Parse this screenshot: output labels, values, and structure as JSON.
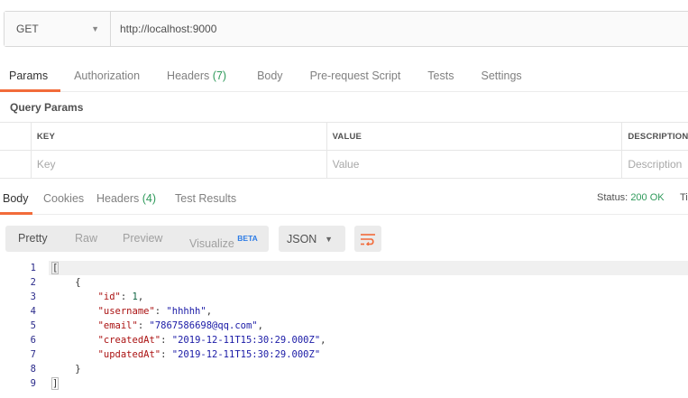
{
  "request": {
    "method": "GET",
    "url": "http://localhost:9000"
  },
  "request_tabs": [
    {
      "label": "Params",
      "count": ""
    },
    {
      "label": "Authorization",
      "count": ""
    },
    {
      "label": "Headers",
      "count": "(7)"
    },
    {
      "label": "Body",
      "count": ""
    },
    {
      "label": "Pre-request Script",
      "count": ""
    },
    {
      "label": "Tests",
      "count": ""
    },
    {
      "label": "Settings",
      "count": ""
    }
  ],
  "query_params": {
    "title": "Query Params",
    "headers": [
      "KEY",
      "VALUE",
      "DESCRIPTION"
    ],
    "placeholders": [
      "Key",
      "Value",
      "Description"
    ]
  },
  "response_tabs": [
    {
      "label": "Body",
      "count": ""
    },
    {
      "label": "Cookies",
      "count": ""
    },
    {
      "label": "Headers",
      "count": "(4)"
    },
    {
      "label": "Test Results",
      "count": ""
    }
  ],
  "status": {
    "label": "Status:",
    "value": "200 OK",
    "extra": "Ti"
  },
  "view_modes": [
    {
      "label": "Pretty",
      "badge": ""
    },
    {
      "label": "Raw",
      "badge": ""
    },
    {
      "label": "Preview",
      "badge": ""
    },
    {
      "label": "Visualize",
      "badge": "BETA"
    }
  ],
  "format": "JSON",
  "icons": {
    "method_dropdown": "chevron-down-icon",
    "format_dropdown": "chevron-down-icon",
    "wrap": "wrap-lines-icon"
  },
  "colors": {
    "accent": "#f26b3a",
    "count": "#2f9a5b",
    "beta": "#2d7ce6"
  },
  "response_body": {
    "line_numbers": [
      "1",
      "2",
      "3",
      "4",
      "5",
      "6",
      "7",
      "8",
      "9"
    ],
    "open_bracket": "[",
    "open_brace": "{",
    "fields": [
      {
        "key": "\"id\"",
        "value": "1",
        "kind": "n",
        "comma": ","
      },
      {
        "key": "\"username\"",
        "value": "\"hhhhh\"",
        "kind": "s",
        "comma": ","
      },
      {
        "key": "\"email\"",
        "value": "\"7867586698@qq.com\"",
        "kind": "s",
        "comma": ","
      },
      {
        "key": "\"createdAt\"",
        "value": "\"2019-12-11T15:30:29.000Z\"",
        "kind": "s",
        "comma": ","
      },
      {
        "key": "\"updatedAt\"",
        "value": "\"2019-12-11T15:30:29.000Z\"",
        "kind": "s",
        "comma": ""
      }
    ],
    "close_brace": "}",
    "close_bracket": "]"
  }
}
